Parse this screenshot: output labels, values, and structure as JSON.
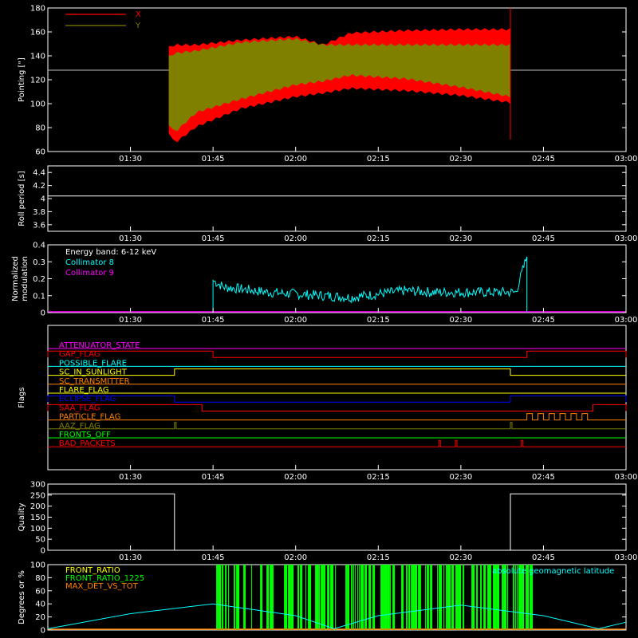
{
  "chart_data": [
    {
      "type": "line",
      "ylabel": "Pointing [\"]",
      "ylim": [
        60,
        180
      ],
      "yticks": [
        60,
        80,
        100,
        120,
        140,
        160,
        180
      ],
      "xlim": [
        "01:15",
        "03:00"
      ],
      "xticks": [
        "01:30",
        "01:45",
        "02:00",
        "02:15",
        "02:30",
        "02:45",
        "03:00"
      ],
      "reference_line": 128,
      "legend": "top-left",
      "series": [
        {
          "name": "X",
          "color": "#ff0000",
          "x": [
            "01:37",
            "01:38",
            "01:42",
            "01:50",
            "02:00",
            "02:05",
            "02:10",
            "02:20",
            "02:30",
            "02:39"
          ],
          "y_low": [
            75,
            66,
            80,
            95,
            105,
            108,
            112,
            110,
            106,
            100
          ],
          "y_high": [
            148,
            150,
            150,
            154,
            157,
            150,
            160,
            162,
            163,
            163
          ]
        },
        {
          "name": "Y",
          "color": "#808000",
          "x": [
            "01:37",
            "01:38",
            "01:42",
            "01:50",
            "02:00",
            "02:05",
            "02:10",
            "02:20",
            "02:30",
            "02:39"
          ],
          "y_low": [
            82,
            75,
            92,
            103,
            115,
            118,
            123,
            120,
            113,
            105
          ],
          "y_high": [
            140,
            143,
            145,
            152,
            155,
            150,
            150,
            150,
            150,
            150
          ]
        }
      ]
    },
    {
      "type": "line",
      "ylabel": "Roll period [s]",
      "ylim": [
        3.5,
        4.5
      ],
      "yticks": [
        3.6,
        3.8,
        4.0,
        4.2,
        4.4
      ],
      "xlim": [
        "01:15",
        "03:00"
      ],
      "xticks": [
        "01:30",
        "01:45",
        "02:00",
        "02:15",
        "02:30",
        "02:45",
        "03:00"
      ],
      "series": [
        {
          "color": "#ffffff",
          "x": [
            "01:15",
            "03:00"
          ],
          "y": [
            4.04,
            4.04
          ]
        }
      ]
    },
    {
      "type": "line",
      "ylabel": "Normalized modulation",
      "ylim": [
        0,
        0.4
      ],
      "yticks": [
        0,
        0.1,
        0.2,
        0.3,
        0.4
      ],
      "xlim": [
        "01:15",
        "03:00"
      ],
      "xticks": [
        "01:30",
        "01:45",
        "02:00",
        "02:15",
        "02:30",
        "02:45",
        "03:00"
      ],
      "legend": "top-left",
      "annotation": "Energy band: 6-12 keV",
      "series": [
        {
          "name": "Collimator 8",
          "color": "#00ffff",
          "x": [
            "01:45",
            "01:47",
            "01:50",
            "01:55",
            "02:00",
            "02:05",
            "02:10",
            "02:15",
            "02:20",
            "02:25",
            "02:30",
            "02:35",
            "02:40",
            "02:42"
          ],
          "y": [
            0.19,
            0.15,
            0.14,
            0.12,
            0.11,
            0.1,
            0.09,
            0.11,
            0.13,
            0.12,
            0.12,
            0.12,
            0.12,
            0.33
          ]
        },
        {
          "name": "Collimator 9",
          "color": "#ff00ff",
          "x": [
            "01:15",
            "03:00"
          ],
          "y": [
            0,
            0
          ]
        }
      ]
    },
    {
      "type": "line",
      "ylabel": "Flags",
      "xlim": [
        "01:15",
        "03:00"
      ],
      "xticks": [
        "01:30",
        "01:45",
        "02:00",
        "02:15",
        "02:30",
        "02:45",
        "03:00"
      ],
      "series": [
        {
          "name": "ATTENUATOR_STATE",
          "color": "#ff00ff",
          "segments": []
        },
        {
          "name": "GAP_FLAG",
          "color": "#ff0000",
          "segments": [
            [
              "01:15",
              "01:45"
            ],
            [
              "02:42",
              "03:00"
            ]
          ]
        },
        {
          "name": "POSSIBLE_FLARE",
          "color": "#00ffff",
          "segments": []
        },
        {
          "name": "SC_IN_SUNLIGHT",
          "color": "#ffff00",
          "segments": [
            [
              "01:38",
              "02:39"
            ]
          ]
        },
        {
          "name": "SC_TRANSMITTER",
          "color": "#ff8000",
          "segments": []
        },
        {
          "name": "FLARE_FLAG",
          "color": "#ffff00",
          "segments": []
        },
        {
          "name": "ECLIPSE_FLAG",
          "color": "#0000ff",
          "segments": [
            [
              "01:15",
              "01:38"
            ],
            [
              "02:39",
              "03:00"
            ]
          ]
        },
        {
          "name": "SAA_FLAG",
          "color": "#ff0000",
          "segments": [
            [
              "01:15",
              "01:43"
            ],
            [
              "02:54",
              "03:00"
            ]
          ]
        },
        {
          "name": "PARTICLE_FLAG",
          "color": "#ff8000",
          "segments": [
            [
              "02:42",
              "02:43"
            ],
            [
              "02:44",
              "02:45"
            ],
            [
              "02:46",
              "02:47"
            ],
            [
              "02:48",
              "02:49"
            ],
            [
              "02:50",
              "02:51"
            ],
            [
              "02:52",
              "02:53"
            ]
          ]
        },
        {
          "name": "AAZ_FLAG",
          "color": "#808000",
          "segments": [
            [
              "01:38",
              "01:38"
            ],
            [
              "02:39",
              "02:39"
            ]
          ]
        },
        {
          "name": "FRONTS_OFF",
          "color": "#00ff00",
          "segments": []
        },
        {
          "name": "BAD_PACKETS",
          "color": "#ff0000",
          "segments": [
            [
              "02:26",
              "02:26"
            ],
            [
              "02:29",
              "02:29"
            ],
            [
              "02:41",
              "02:41"
            ]
          ]
        }
      ]
    },
    {
      "type": "line",
      "ylabel": "Quality",
      "ylim": [
        0,
        300
      ],
      "yticks": [
        0,
        50,
        100,
        150,
        200,
        250,
        300
      ],
      "xlim": [
        "01:15",
        "03:00"
      ],
      "xticks": [
        "01:30",
        "01:45",
        "02:00",
        "02:15",
        "02:30",
        "02:45",
        "03:00"
      ],
      "series": [
        {
          "color": "#ffffff",
          "x": [
            "01:15",
            "01:38",
            "01:38",
            "02:39",
            "02:39",
            "03:00"
          ],
          "y": [
            256,
            256,
            0,
            0,
            256,
            256
          ]
        }
      ]
    },
    {
      "type": "line",
      "ylabel": "Degrees or %",
      "ylim": [
        0,
        100
      ],
      "yticks": [
        0,
        20,
        40,
        60,
        80,
        100
      ],
      "xlim": [
        "01:15",
        "03:00"
      ],
      "legend": "top-left",
      "series": [
        {
          "name": "FRONT_RATIO",
          "color": "#ffff00",
          "x": [],
          "y": []
        },
        {
          "name": "FRONT_RATIO_1225",
          "color": "#00ff00",
          "segments": [
            [
              "01:45",
              "02:43"
            ]
          ],
          "y": 100
        },
        {
          "name": "MAX_DET_VS_TOT",
          "color": "#ff8000",
          "x": [
            "01:15",
            "03:00"
          ],
          "y": [
            0,
            0
          ]
        },
        {
          "name": "absolute geomagnetic latitude",
          "color": "#00ffff",
          "x": [
            "01:15",
            "01:30",
            "01:45",
            "02:00",
            "02:07",
            "02:15",
            "02:30",
            "02:45",
            "02:55",
            "03:00"
          ],
          "y": [
            2,
            25,
            40,
            22,
            2,
            22,
            38,
            22,
            2,
            12
          ]
        }
      ]
    }
  ]
}
